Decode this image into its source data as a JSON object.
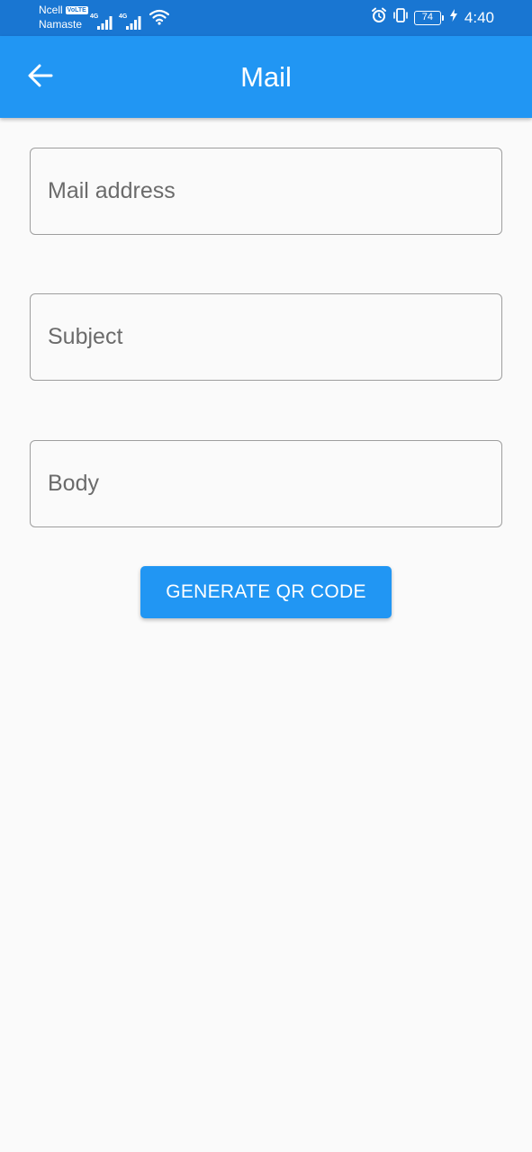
{
  "status_bar": {
    "carrier": "Ncell",
    "volte": "VoLTE",
    "carrier_sub": "Namaste",
    "sim1_network": "4G",
    "sim2_network": "4G",
    "battery": "74",
    "time": "4:40"
  },
  "app_bar": {
    "title": "Mail",
    "back_icon": "arrow-back-icon"
  },
  "form": {
    "mail_placeholder": "Mail address",
    "subject_placeholder": "Subject",
    "body_placeholder": "Body"
  },
  "actions": {
    "generate_label": "GENERATE QR CODE"
  },
  "colors": {
    "status_bar": "#1976d2",
    "primary": "#2196f3",
    "background": "#fafafa",
    "field_border": "#9e9e9e"
  }
}
